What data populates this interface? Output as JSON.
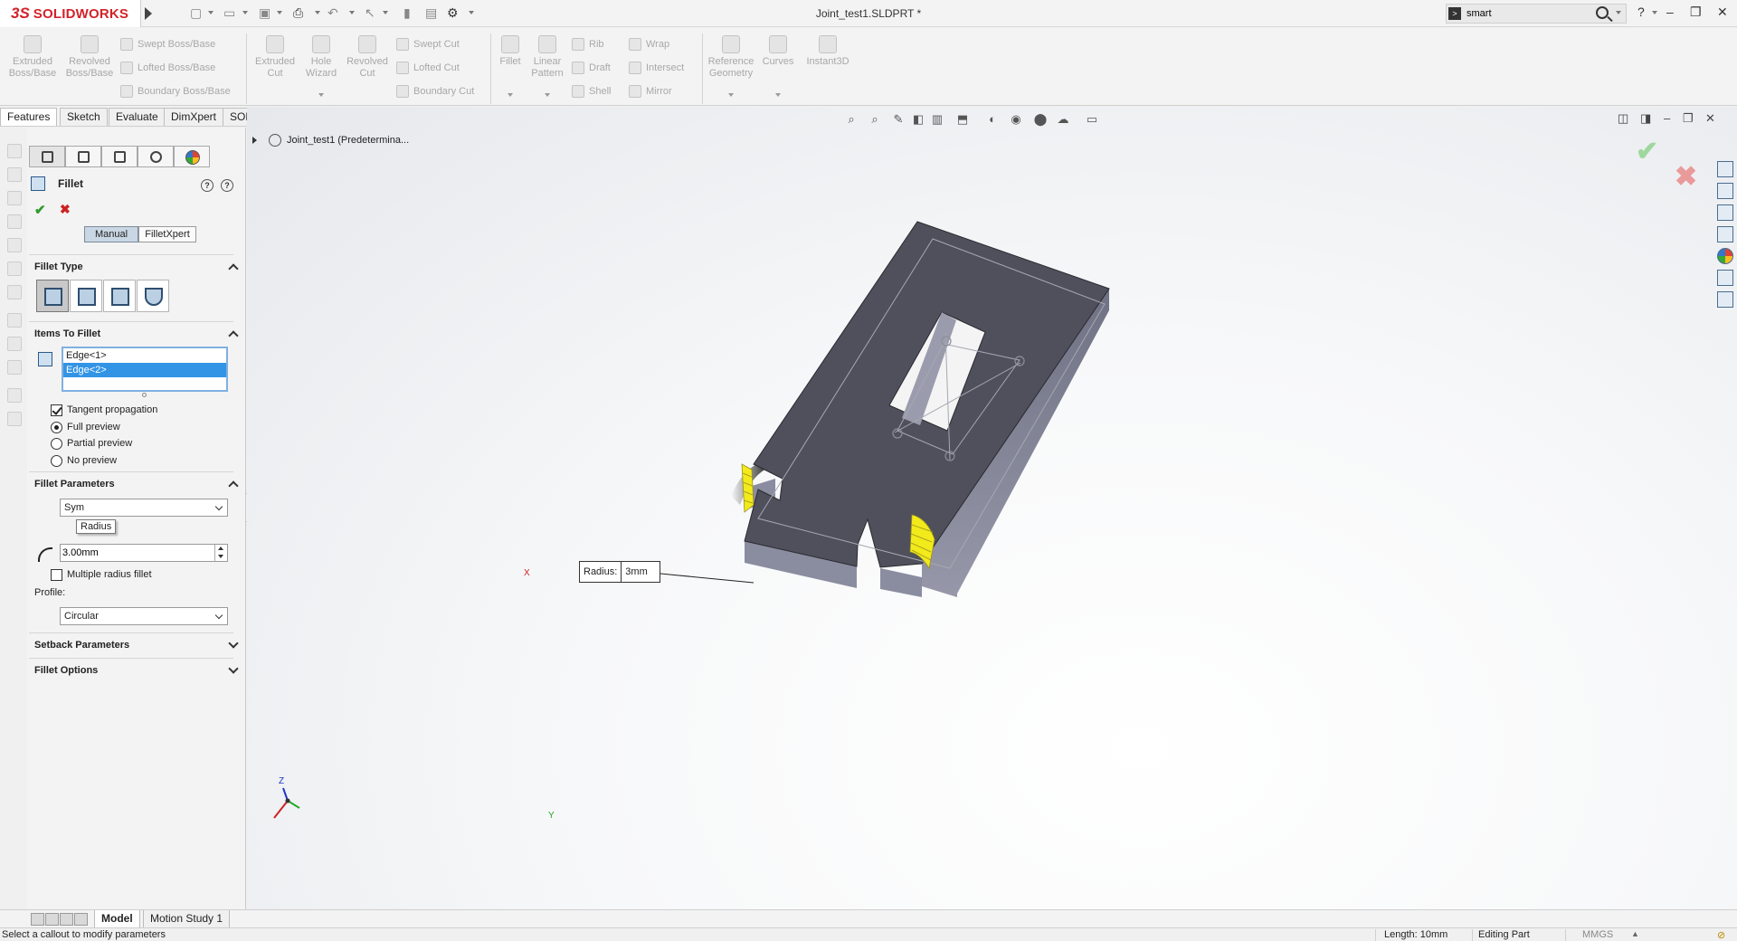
{
  "app": {
    "brand_ds": "3S",
    "brand_name": "SOLIDWORKS",
    "document_title": "Joint_test1.SLDPRT *",
    "search_value": "smart",
    "help_label": "?"
  },
  "command_manager": {
    "extruded_boss": "Extruded Boss/Base",
    "revolved_boss": "Revolved Boss/Base",
    "swept_boss": "Swept Boss/Base",
    "lofted_boss": "Lofted Boss/Base",
    "boundary_boss": "Boundary Boss/Base",
    "extruded_cut": "Extruded Cut",
    "hole_wizard": "Hole Wizard",
    "revolved_cut": "Revolved Cut",
    "swept_cut": "Swept Cut",
    "lofted_cut": "Lofted Cut",
    "boundary_cut": "Boundary Cut",
    "fillet": "Fillet",
    "linear_pattern": "Linear Pattern",
    "rib": "Rib",
    "draft": "Draft",
    "shell": "Shell",
    "wrap": "Wrap",
    "intersect": "Intersect",
    "mirror": "Mirror",
    "reference_geometry": "Reference Geometry",
    "curves": "Curves",
    "instant3d": "Instant3D"
  },
  "tabs": [
    "Features",
    "Sketch",
    "Evaluate",
    "DimXpert",
    "SOLIDWORKS Add-Ins"
  ],
  "property_manager": {
    "title": "Fillet",
    "mode_manual": "Manual",
    "mode_filletxpert": "FilletXpert",
    "fillet_type_title": "Fillet Type",
    "items_title": "Items To Fillet",
    "edges": [
      "Edge<1>",
      "Edge<2>"
    ],
    "tangent_propagation": "Tangent propagation",
    "full_preview": "Full preview",
    "partial_preview": "Partial preview",
    "no_preview": "No preview",
    "fillet_params_title": "Fillet Parameters",
    "symmetric_value": "Sym",
    "tooltip": "Radius",
    "radius_value": "3.00mm",
    "multiple_radius": "Multiple radius fillet",
    "profile_label": "Profile:",
    "profile_value": "Circular",
    "setback_title": "Setback Parameters",
    "fillet_options_title": "Fillet Options"
  },
  "viewport": {
    "tree_root": "Joint_test1  (Predetermina...",
    "callout_key": "Radius:",
    "callout_value": "3mm",
    "triad_x": "X",
    "triad_y": "Y",
    "triad_z": "Z"
  },
  "bottom_tabs": [
    "Model",
    "Motion Study 1"
  ],
  "status": {
    "message": "Select a callout to modify parameters",
    "length": "Length: 10mm",
    "mode": "Editing Part",
    "units": "MMGS"
  },
  "colors": {
    "brand_red": "#d2232a",
    "part_top": "#4e4f5a",
    "part_side": "#7c7f92",
    "fillet_preview": "#f2ea1a",
    "selection_blue": "#3394e6"
  }
}
